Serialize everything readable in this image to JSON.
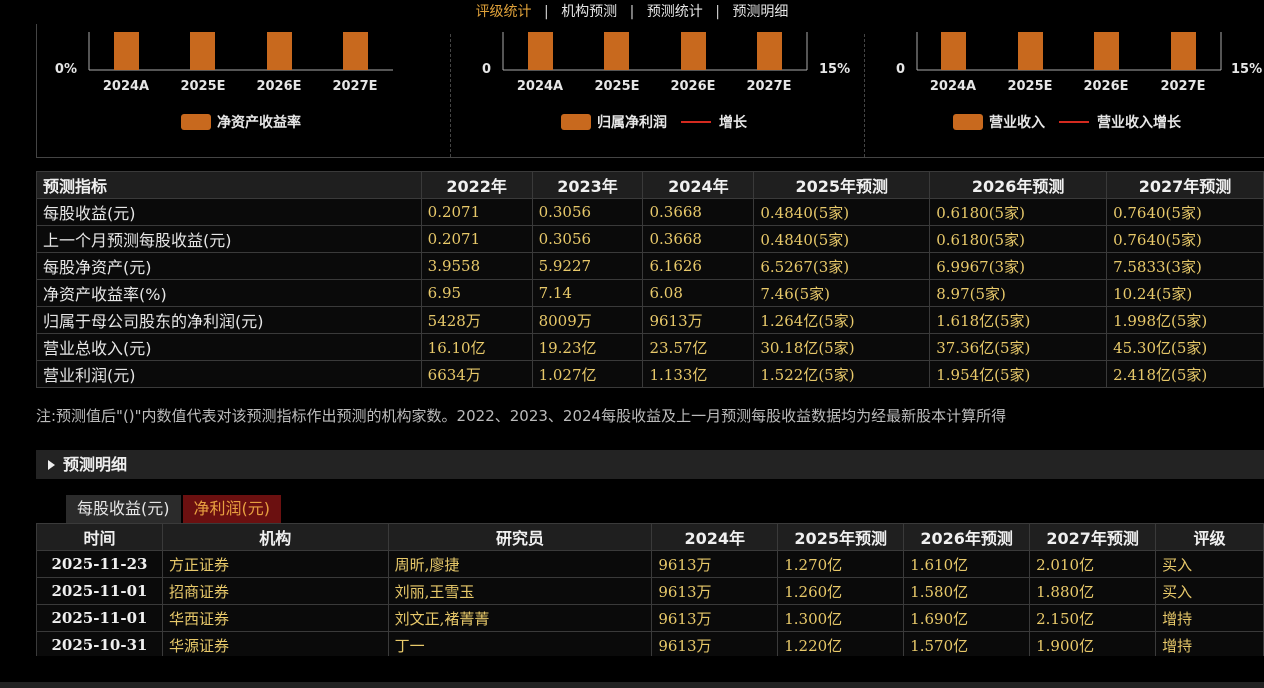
{
  "nav": {
    "items": [
      "评级统计",
      "机构预测",
      "预测统计",
      "预测明细"
    ],
    "separator": "|"
  },
  "charts": [
    {
      "type": "bar",
      "categories": [
        "2024A",
        "2025E",
        "2026E",
        "2027E"
      ],
      "left_axis_label": "0%",
      "right_axis_label": "",
      "legend_bar": "净资产收益率",
      "legend_line": ""
    },
    {
      "type": "bar+line",
      "categories": [
        "2024A",
        "2025E",
        "2026E",
        "2027E"
      ],
      "left_axis_label": "0",
      "right_axis_label": "15%",
      "legend_bar": "归属净利润",
      "legend_line": "增长"
    },
    {
      "type": "bar+line",
      "categories": [
        "2024A",
        "2025E",
        "2026E",
        "2027E"
      ],
      "left_axis_label": "0",
      "right_axis_label": "15%",
      "legend_bar": "营业收入",
      "legend_line": "营业收入增长"
    }
  ],
  "colors": {
    "bar": "#c8691e",
    "line": "#d42a1f",
    "accent": "#e0a23a",
    "value": "#e8c96a"
  },
  "forecast_table": {
    "headers": [
      "预测指标",
      "2022年",
      "2023年",
      "2024年",
      "2025年预测",
      "2026年预测",
      "2027年预测"
    ],
    "rows": [
      [
        "每股收益(元)",
        "0.2071",
        "0.3056",
        "0.3668",
        "0.4840(5家)",
        "0.6180(5家)",
        "0.7640(5家)"
      ],
      [
        "上一个月预测每股收益(元)",
        "0.2071",
        "0.3056",
        "0.3668",
        "0.4840(5家)",
        "0.6180(5家)",
        "0.7640(5家)"
      ],
      [
        "每股净资产(元)",
        "3.9558",
        "5.9227",
        "6.1626",
        "6.5267(3家)",
        "6.9967(3家)",
        "7.5833(3家)"
      ],
      [
        "净资产收益率(%)",
        "6.95",
        "7.14",
        "6.08",
        "7.46(5家)",
        "8.97(5家)",
        "10.24(5家)"
      ],
      [
        "归属于母公司股东的净利润(元)",
        "5428万",
        "8009万",
        "9613万",
        "1.264亿(5家)",
        "1.618亿(5家)",
        "1.998亿(5家)"
      ],
      [
        "营业总收入(元)",
        "16.10亿",
        "19.23亿",
        "23.57亿",
        "30.18亿(5家)",
        "37.36亿(5家)",
        "45.30亿(5家)"
      ],
      [
        "营业利润(元)",
        "6634万",
        "1.027亿",
        "1.133亿",
        "1.522亿(5家)",
        "1.954亿(5家)",
        "2.418亿(5家)"
      ]
    ]
  },
  "note": "注:预测值后\"()\"内数值代表对该预测指标作出预测的机构家数。2022、2023、2024每股收益及上一月预测每股收益数据均为经最新股本计算所得",
  "section_title": "预测明细",
  "tabs": [
    {
      "label": "每股收益(元)",
      "active": false
    },
    {
      "label": "净利润(元)",
      "active": true
    }
  ],
  "detail_table": {
    "headers": [
      "时间",
      "机构",
      "研究员",
      "2024年",
      "2025年预测",
      "2026年预测",
      "2027年预测",
      "评级"
    ],
    "rows": [
      [
        "2025-11-23",
        "方正证券",
        "周昕,廖捷",
        "9613万",
        "1.270亿",
        "1.610亿",
        "2.010亿",
        "买入"
      ],
      [
        "2025-11-01",
        "招商证券",
        "刘丽,王雪玉",
        "9613万",
        "1.260亿",
        "1.580亿",
        "1.880亿",
        "买入"
      ],
      [
        "2025-11-01",
        "华西证券",
        "刘文正,褚菁菁",
        "9613万",
        "1.300亿",
        "1.690亿",
        "2.150亿",
        "增持"
      ],
      [
        "2025-10-31",
        "华源证券",
        "丁一",
        "9613万",
        "1.220亿",
        "1.570亿",
        "1.900亿",
        "增持"
      ]
    ]
  }
}
